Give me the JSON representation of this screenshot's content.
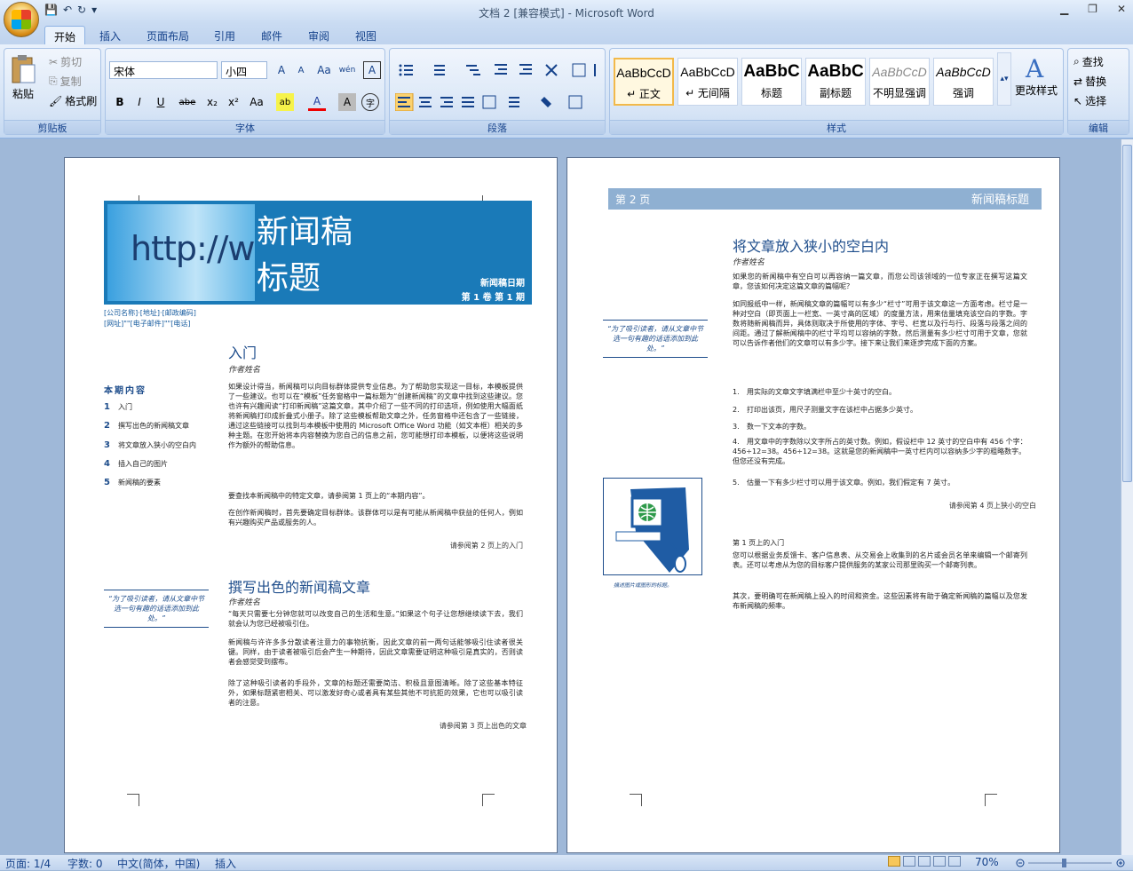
{
  "window": {
    "title": "文档 2 [兼容模式] - Microsoft Word",
    "min": "▁",
    "max": "❐",
    "close": "✕"
  },
  "qat": {
    "save": "💾",
    "undo": "↶",
    "redo": "↻",
    "more": "▾"
  },
  "tabs": [
    "开始",
    "插入",
    "页面布局",
    "引用",
    "邮件",
    "审阅",
    "视图"
  ],
  "clipboard": {
    "paste": "粘贴",
    "cut": "剪切",
    "copy": "复制",
    "format_painter": "格式刷",
    "label": "剪贴板"
  },
  "font": {
    "name": "宋体",
    "size": "小四",
    "label": "字体",
    "buttons": [
      "A",
      "A",
      "Aa",
      "wén",
      "A",
      "B",
      "I",
      "U",
      "abe",
      "x₂",
      "x²",
      "Aa",
      "ab",
      "A",
      "A",
      "字"
    ]
  },
  "paragraph": {
    "label": "段落"
  },
  "styles": {
    "label": "样式",
    "items": [
      {
        "sample": "AaBbCcD",
        "name": "↵ 正文"
      },
      {
        "sample": "AaBbCcD",
        "name": "↵ 无间隔"
      },
      {
        "sample": "AaBbC",
        "name": "标题"
      },
      {
        "sample": "AaBbC",
        "name": "副标题"
      },
      {
        "sample": "AaBbCcD",
        "name": "不明显强调"
      },
      {
        "sample": "AaBbCcD",
        "name": "强调"
      }
    ],
    "change": "更改样式"
  },
  "editing": {
    "label": "编辑",
    "find": "查找",
    "replace": "替换",
    "select": "选择"
  },
  "page1": {
    "banner_url": "http://www",
    "title1": "新闻稿",
    "title2": "标题",
    "date": "新闻稿日期",
    "vol": "第 1 卷 第 1 期",
    "company": "[公司名称]·[地址]·[邮政编码]",
    "web": "[网址]\"\"[电子邮件]\"\"[电话]",
    "toc_title": "本期内容",
    "toc": [
      {
        "n": "1",
        "t": "入门"
      },
      {
        "n": "2",
        "t": "撰写出色的新闻稿文章"
      },
      {
        "n": "3",
        "t": "将文章放入狭小的空白内"
      },
      {
        "n": "4",
        "t": "插入自己的图片"
      },
      {
        "n": "5",
        "t": "新闻稿的要素"
      }
    ],
    "s1_title": "入门",
    "s1_author": "作者姓名",
    "s1_p1": "如果设计得当，新闻稿可以向目标群体提供专业信息。为了帮助您实现这一目标，本模板提供了一些建议。也可以在“模板”任务窗格中一篇标题为“创建新闻稿”的文章中找到这些建议。您也许有兴趣阅读“打印新闻稿”这篇文章，其中介绍了一些不同的打印选项，例如使用大幅面纸将新闻稿打印成折叠式小册子。除了这些模板帮助文章之外，任务窗格中还包含了一些链接，通过这些链接可以找到与本模板中使用的 Microsoft Office Word 功能（如文本框）相关的多种主题。在您开始将本内容替换为您自己的信息之前，您可能想打印本模板，以便将这些说明作为额外的帮助信息。",
    "s1_p2": "要查找本新闻稿中的特定文章，请参阅第 1 页上的“本期内容”。",
    "s1_p3": "在创作新闻稿时，首先要确定目标群体。该群体可以是有可能从新闻稿中获益的任何人，例如有兴趣购买产品或服务的人。",
    "s1_see": "请参阅第 2 页上的入门",
    "quote": "“为了吸引读者，请从文章中节选一句有趣的话语添加到此处。”",
    "s2_title": "撰写出色的新闻稿文章",
    "s2_author": "作者姓名",
    "s2_p1": "“每天只需要七分钟您就可以改变自己的生活和生意。”如果这个句子让您想继续读下去，我们就会认为您已经被吸引住。",
    "s2_p2": "新闻稿与许许多多分散读者注意力的事物抗衡，因此文章的前一两句话能够吸引住读者很关键。同样，由于读者被吸引后会产生一种期待，因此文章需要证明这种吸引是真实的，否则读者会感觉受到摆布。",
    "s2_p3": "除了这种吸引读者的手段外，文章的标题还需要简洁、积极且意图清晰。除了这些基本特征外，如果标题紧密相关、可以激发好奇心或者具有某些其他不可抗拒的效果，它也可以吸引读者的注意。",
    "s2_see": "请参阅第 3 页上出色的文章"
  },
  "page2": {
    "header_page": "第 2 页",
    "header_title": "新闻稿标题",
    "s3_title": "将文章放入狭小的空白内",
    "s3_author": "作者姓名",
    "s3_p1": "如果您的新闻稿中有空白可以再容纳一篇文章，而您公司该领域的一位专家正在撰写这篇文章，您该如何决定这篇文章的篇幅呢？",
    "s3_p2": "如同报纸中一样，新闻稿文章的篇幅可以有多少“栏寸”可用于该文章这一方面考虑。栏寸是一种对空白（即页面上一栏宽、一英寸高的区域）的度量方法，用来估量填充该空白的字数。字数将随新闻稿而异，具体则取决于所使用的字体、字号、栏宽以及行与行、段落与段落之间的间距。通过了解新闻稿中的栏寸平均可以容纳的字数，然后测量有多少栏寸可用于文章，您就可以告诉作者他们的文章可以有多少字。接下来让我们来逐步完成下面的方案。",
    "list": [
      {
        "n": "1.",
        "t": "用实际的文章文字填满栏中至少十英寸的空白。"
      },
      {
        "n": "2.",
        "t": "打印出该页，用尺子测量文字在该栏中占据多少英寸。"
      },
      {
        "n": "3.",
        "t": "数一下文本的字数。"
      },
      {
        "n": "4.",
        "t": "用文章中的字数除以文字所占的英寸数。例如，假设栏中 12 英寸的空白中有 456 个字：456÷12=38。456÷12=38。这就是您的新闻稿中一英寸栏内可以容纳多少字的粗略数字。但您还没有完成。"
      },
      {
        "n": "5.",
        "t": "估量一下有多少栏寸可以用于该文章。例如，我们假定有 7 英寸。"
      }
    ],
    "s3_see": "请参阅第 4 页上狭小的空白",
    "quote": "“为了吸引读者，请从文章中节选一句有趣的话语添加到此处。”",
    "caption": "描述图片或图形的标题。",
    "cont_title": "第 1 页上的入门",
    "cont_p1": "您可以根据业务反馈卡、客户信息表、从交易会上收集到的名片或会员名单来编辑一个邮寄列表。还可以考虑从为您的目标客户提供服务的某家公司那里购买一个邮寄列表。",
    "cont_p2": "其次，要明确可在新闻稿上投入的时间和资金。这些因素将有助于确定新闻稿的篇幅以及您发布新闻稿的频率。"
  },
  "status": {
    "page": "页面: 1/4",
    "words": "字数: 0",
    "lang": "中文(简体，中国)",
    "mode": "插入",
    "zoom": "70%"
  }
}
